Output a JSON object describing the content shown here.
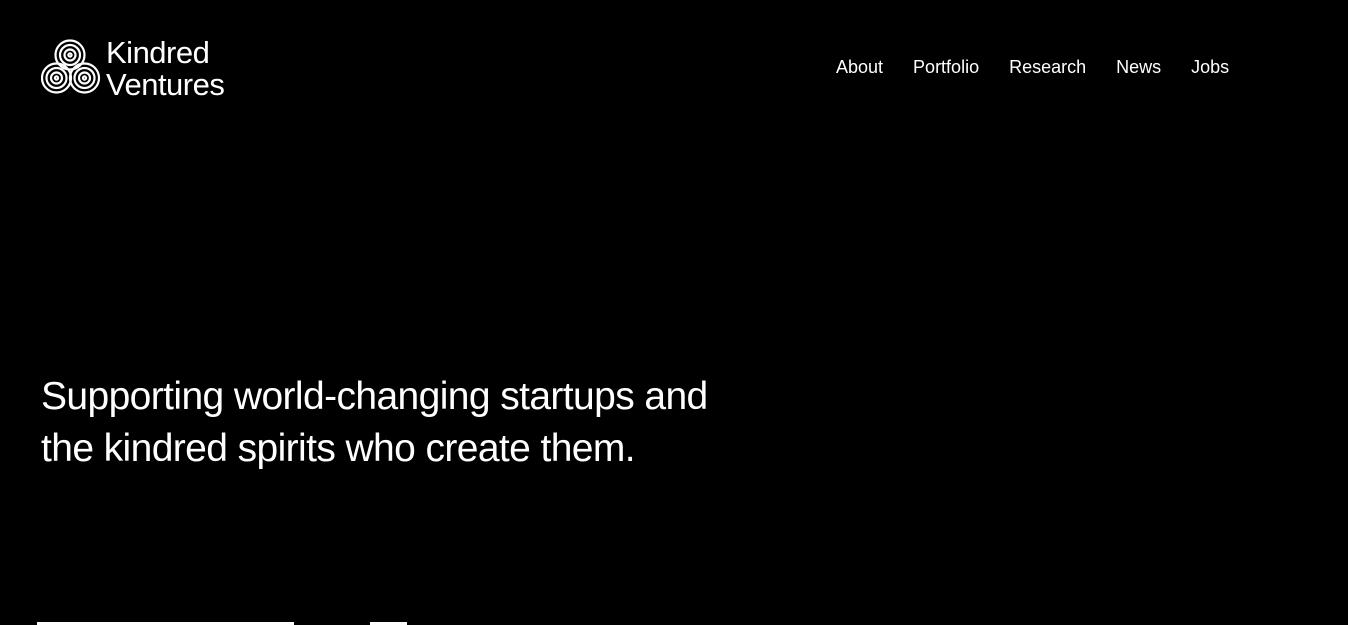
{
  "brand": {
    "name_line1": "Kindred",
    "name_line2": "Ventures",
    "logo_icon": "concentric-circles-icon"
  },
  "nav": {
    "items": [
      {
        "label": "About"
      },
      {
        "label": "Portfolio"
      },
      {
        "label": "Research"
      },
      {
        "label": "News"
      },
      {
        "label": "Jobs"
      }
    ]
  },
  "hero": {
    "headline": "Supporting world-changing startups and the kindred spirits who create them."
  },
  "colors": {
    "background": "#000000",
    "text": "#ffffff"
  }
}
